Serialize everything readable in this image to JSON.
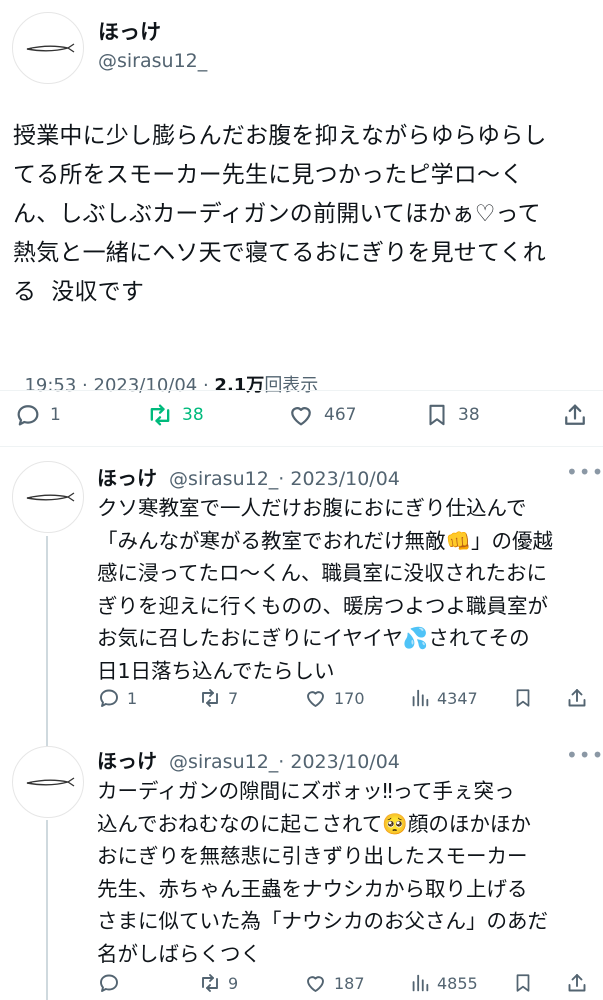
{
  "main_tweet": {
    "author_name": "ほっけ",
    "handle": "@sirasu12_",
    "body_lines": [
      "授業中に少し膨らんだお腹を抑えながらゆらゆらし",
      "てる所をスモーカー先生に見つかったピ学ロ〜く",
      "ん、しぶしぶカーディガンの前開いてほかぁ♡って",
      "熱気と一緒にヘソ天で寝てるおにぎりを見せてくれ",
      "る  没収です"
    ],
    "time": "19:53",
    "sep1": " · ",
    "date": "2023/10/04",
    "sep2": " · ",
    "views": "2.1万",
    "views_label": "回表示",
    "replies": "1",
    "retweets": "38",
    "likes": "467",
    "bookmarks": "38"
  },
  "replies": [
    {
      "author_name": "ほっけ",
      "handle": "@sirasu12_",
      "date": "· 2023/10/04",
      "more": "•••",
      "body_lines": [
        "クソ寒教室で一人だけお腹におにぎり仕込んで",
        "「みんなが寒がる教室でおれだけ無敵👊」の優越",
        "感に浸ってたロ〜くん、職員室に没収されたおに",
        "ぎりを迎えに行くものの、暖房つよつよ職員室が",
        "お気に召したおにぎりにイヤイヤ💦されてその",
        "日1日落ち込んでたらしい"
      ],
      "replies": "1",
      "retweets": "7",
      "likes": "170",
      "views": "4347"
    },
    {
      "author_name": "ほっけ",
      "handle": "@sirasu12_",
      "date": "· 2023/10/04",
      "more": "•••",
      "body_lines": [
        "カーディガンの隙間にズボォッ‼って手ぇ突っ",
        "込んでおねむなのに起こされて🥺顔のほかほか",
        "おにぎりを無慈悲に引きずり出したスモーカー",
        "先生、赤ちゃん王蟲をナウシカから取り上げる",
        "さまに似ていた為「ナウシカのお父さん」のあだ",
        "名がしばらくつく"
      ],
      "replies": "",
      "retweets": "9",
      "likes": "187",
      "views": "4855"
    }
  ],
  "colors": {
    "retweet_active": "#00ba7c",
    "muted": "#536471",
    "text": "#0f1419"
  }
}
